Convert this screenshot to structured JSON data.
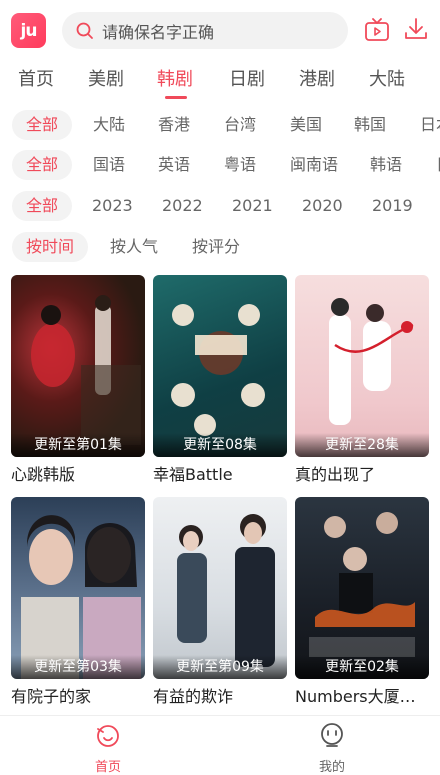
{
  "header": {
    "logo_text": "ju",
    "search_placeholder": "请确保名字正确",
    "accent": "#f04a5a"
  },
  "tabs": [
    {
      "label": "首页",
      "active": false
    },
    {
      "label": "美剧",
      "active": false
    },
    {
      "label": "韩剧",
      "active": true
    },
    {
      "label": "日剧",
      "active": false
    },
    {
      "label": "港剧",
      "active": false
    },
    {
      "label": "大陆",
      "active": false
    }
  ],
  "filters": {
    "region": [
      "全部",
      "大陆",
      "香港",
      "台湾",
      "美国",
      "韩国",
      "日本"
    ],
    "language": [
      "全部",
      "国语",
      "英语",
      "粤语",
      "闽南语",
      "韩语",
      "日语"
    ],
    "year": [
      "全部",
      "2023",
      "2022",
      "2021",
      "2020",
      "2019"
    ],
    "sort": [
      "按时间",
      "按人气",
      "按评分"
    ]
  },
  "items": [
    {
      "title": "心跳韩版",
      "badge": "更新至第01集",
      "icon": "poster-dark-red"
    },
    {
      "title": "幸福Battle",
      "badge": "更新至08集",
      "icon": "poster-teal"
    },
    {
      "title": "真的出现了",
      "badge": "更新至28集",
      "icon": "poster-pink"
    },
    {
      "title": "有院子的家",
      "badge": "更新至第03集",
      "icon": "poster-blue"
    },
    {
      "title": "有益的欺诈",
      "badge": "更新至第09集",
      "icon": "poster-grey"
    },
    {
      "title": "Numbers大厦森林的监…",
      "badge": "更新至02集",
      "icon": "poster-dark"
    }
  ],
  "bottom_nav": [
    {
      "label": "首页",
      "icon": "home-bubble-icon",
      "active": true
    },
    {
      "label": "我的",
      "icon": "profile-face-icon",
      "active": false
    }
  ]
}
